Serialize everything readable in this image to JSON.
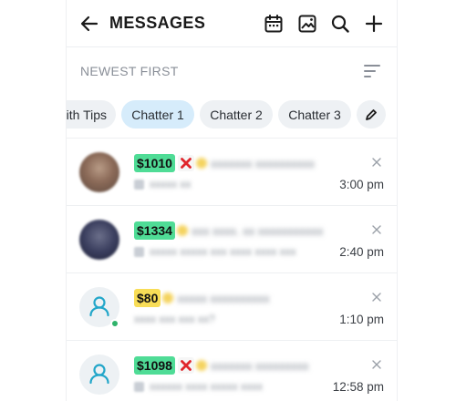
{
  "header": {
    "title": "MESSAGES"
  },
  "sort": {
    "label": "NEWEST FIRST"
  },
  "chips": [
    {
      "label": "ith Tips",
      "active": false
    },
    {
      "label": "Chatter 1",
      "active": true
    },
    {
      "label": "Chatter 2",
      "active": false
    },
    {
      "label": "Chatter 3",
      "active": false
    }
  ],
  "colors": {
    "money_badge_green": "#4fdc96",
    "money_badge_yellow": "#f8dd57",
    "active_chip": "#d6ecfb",
    "avatar_accent": "#22a6c9",
    "online_dot": "#2fb36b",
    "x_mark": "#e0262c"
  },
  "conversations": [
    {
      "amount": "$1010",
      "time": "3:00 pm",
      "avatar": "photo"
    },
    {
      "amount": "$1334",
      "time": "2:40 pm",
      "avatar": "photo"
    },
    {
      "amount": "$80",
      "time": "1:10 pm",
      "avatar": "default-user-icon"
    },
    {
      "amount": "$1098",
      "time": "12:58 pm",
      "avatar": "default-user-icon"
    }
  ]
}
